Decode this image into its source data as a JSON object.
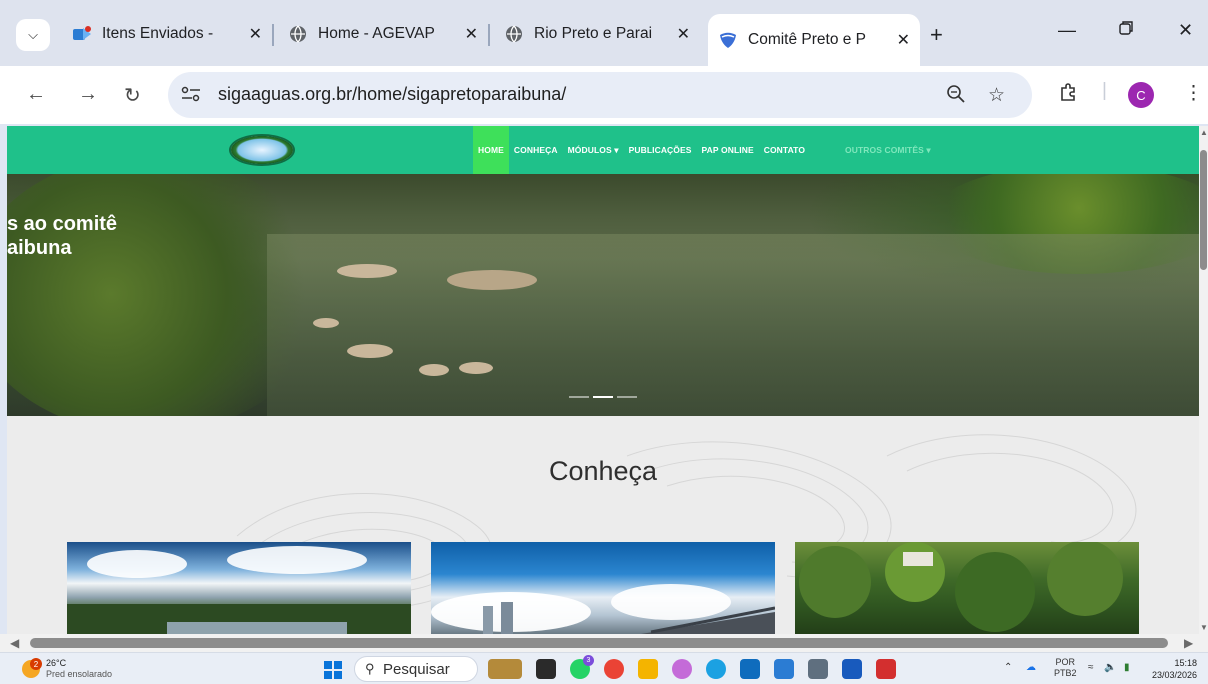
{
  "browser": {
    "tabs": [
      {
        "title": "Itens Enviados - ",
        "icon": "outlook-icon",
        "active": false
      },
      {
        "title": "Home - AGEVAP",
        "icon": "globe-icon",
        "active": false
      },
      {
        "title": "Rio Preto e Parai",
        "icon": "globe-icon",
        "active": false
      },
      {
        "title": "Comitê Preto e P",
        "icon": "shield-icon",
        "active": true
      }
    ],
    "close_glyph": "✕",
    "new_tab_glyph": "+",
    "url": "sigaaguas.org.br/home/sigapretoparaibuna/",
    "profile_initial": "C"
  },
  "site": {
    "menu": [
      {
        "label": "HOME",
        "active": true
      },
      {
        "label": "CONHEÇA"
      },
      {
        "label": "MÓDULOS ▾"
      },
      {
        "label": "PUBLICAÇÕES"
      },
      {
        "label": "PAP ONLINE"
      },
      {
        "label": "CONTATO"
      },
      {
        "label": "OUTROS COMITÊS ▾",
        "dimmed": true
      }
    ],
    "hero_line1": "s ao comitê",
    "hero_line2": "aibuna",
    "section_title": "Conheça",
    "colors": {
      "nav": "#1fc18a",
      "home_active": "#3ee05a"
    }
  },
  "taskbar": {
    "temperature": "26°C",
    "weather_desc": "Pred ensolarado",
    "weather_badge": "2",
    "search_label": "Pesquisar",
    "whatsapp_badge": "3",
    "lang_top": "POR",
    "lang_bottom": "PTB2",
    "time": "15:18",
    "date": "23/03/2026"
  }
}
